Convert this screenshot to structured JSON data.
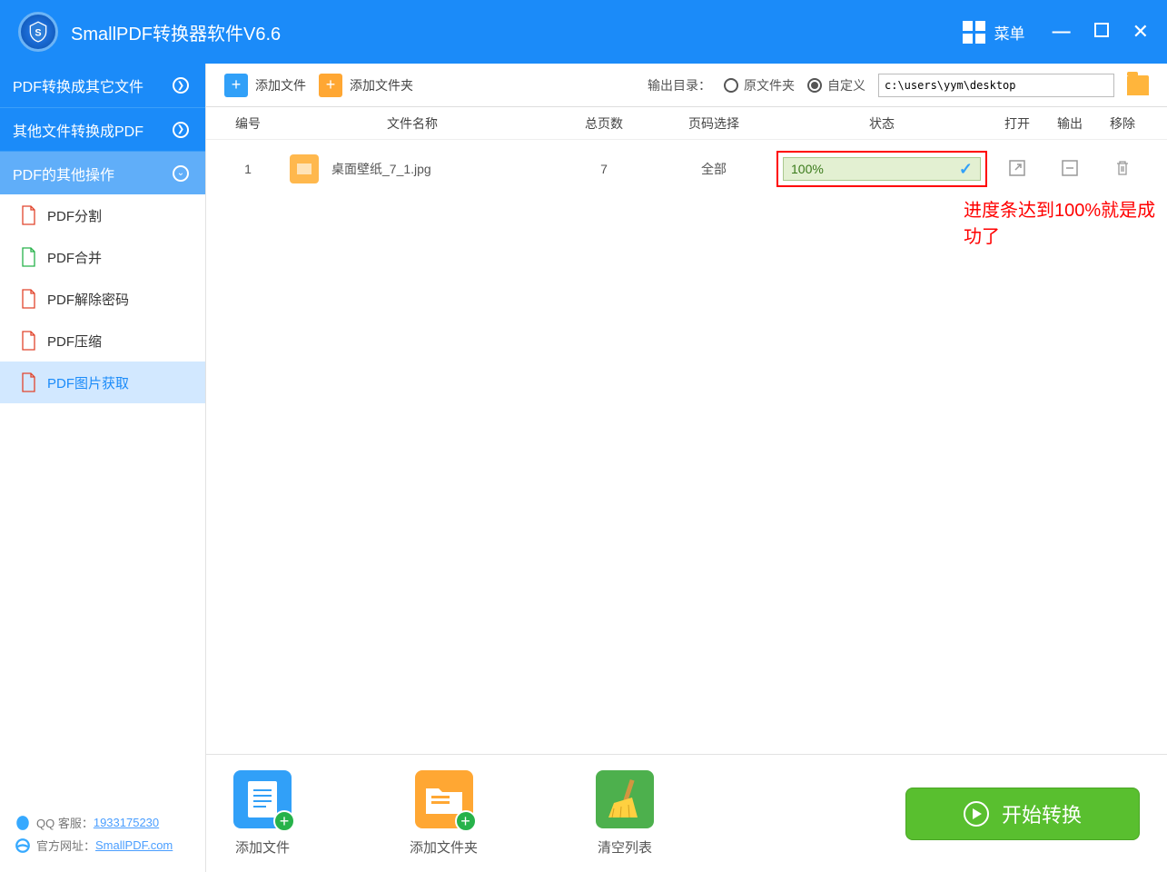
{
  "app": {
    "title": "SmallPDF转换器软件V6.6",
    "menu_label": "菜单"
  },
  "nav": {
    "items": [
      {
        "label": "PDF转换成其它文件"
      },
      {
        "label": "其他文件转换成PDF"
      },
      {
        "label": "PDF的其他操作"
      }
    ],
    "sub": [
      {
        "label": "PDF分割",
        "color": "#e1452c"
      },
      {
        "label": "PDF合并",
        "color": "#27b24a"
      },
      {
        "label": "PDF解除密码",
        "color": "#e1452c"
      },
      {
        "label": "PDF压缩",
        "color": "#e1452c"
      },
      {
        "label": "PDF图片获取",
        "color": "#e1452c"
      }
    ]
  },
  "footer": {
    "qq_label": "QQ 客服：",
    "qq_value": "1933175230",
    "site_label": "官方网址：",
    "site_value": "SmallPDF.com"
  },
  "toolbar": {
    "add_file": "添加文件",
    "add_folder": "添加文件夹",
    "output_dir": "输出目录：",
    "radio_original": "原文件夹",
    "radio_custom": "自定义",
    "path": "c:\\users\\yym\\desktop"
  },
  "table": {
    "headers": {
      "num": "编号",
      "name": "文件名称",
      "pages": "总页数",
      "pagesel": "页码选择",
      "status": "状态",
      "open": "打开",
      "output": "输出",
      "remove": "移除"
    },
    "rows": [
      {
        "num": "1",
        "name": "桌面壁纸_7_1.jpg",
        "pages": "7",
        "pagesel": "全部",
        "progress": "100%"
      }
    ]
  },
  "annotation": "进度条达到100%就是成功了",
  "bottom": {
    "add_file": "添加文件",
    "add_folder": "添加文件夹",
    "clear_list": "清空列表",
    "start": "开始转换"
  }
}
